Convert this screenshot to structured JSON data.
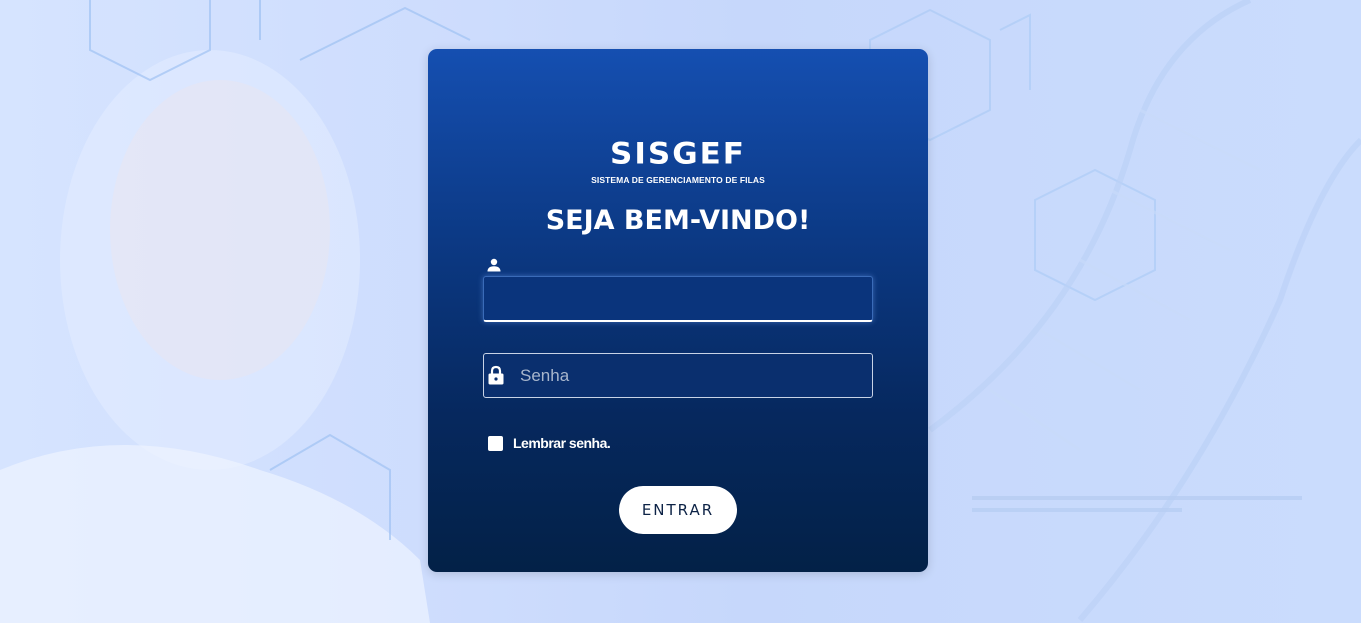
{
  "brand": {
    "logo_text": "SISGEF",
    "subtitle": "SISTEMA DE GERENCIAMENTO DE FILAS"
  },
  "login": {
    "heading": "SEJA BEM-VINDO!",
    "username": {
      "icon": "user-icon",
      "value": "",
      "placeholder": ""
    },
    "password": {
      "icon": "lock-icon",
      "value": "",
      "placeholder": "Senha"
    },
    "remember": {
      "label": "Lembrar senha.",
      "checked": false
    },
    "submit_label": "ENTRAR"
  },
  "colors": {
    "card_top": "#154fb1",
    "card_bottom": "#032147",
    "background": "#cddcfd",
    "button_text": "#0d2346"
  }
}
